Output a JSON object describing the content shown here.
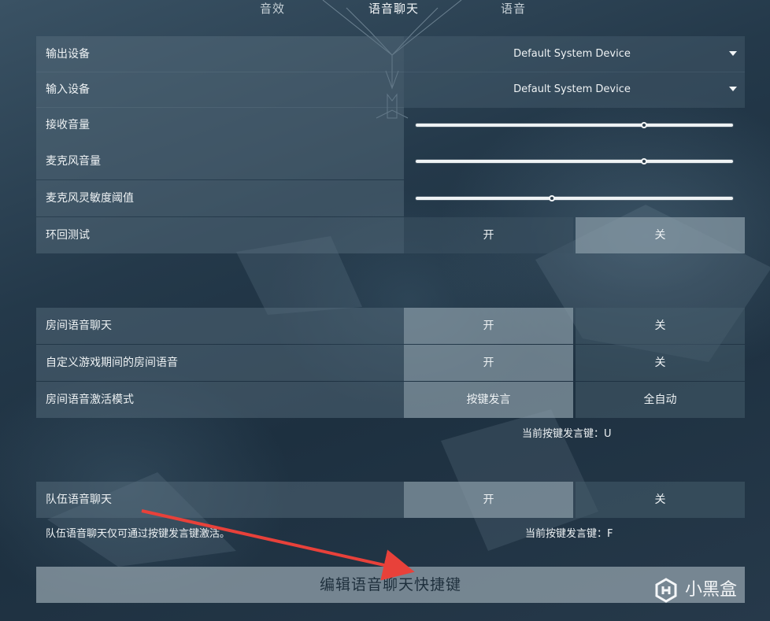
{
  "tabs": [
    {
      "label": "音效"
    },
    {
      "label": "语音聊天"
    },
    {
      "label": "语音"
    }
  ],
  "device": {
    "output": {
      "label": "输出设备",
      "value": "Default System Device"
    },
    "input": {
      "label": "输入设备",
      "value": "Default System Device"
    }
  },
  "sliders": {
    "receive_volume": {
      "label": "接收音量",
      "level": 0.72
    },
    "mic_volume": {
      "label": "麦克风音量",
      "level": 0.72
    },
    "mic_sensitivity": {
      "label": "麦克风灵敏度阈值",
      "level": 0.43
    }
  },
  "loopback": {
    "label": "环回测试",
    "on": "开",
    "off": "关",
    "selected": "off"
  },
  "party": {
    "room_chat": {
      "label": "房间语音聊天",
      "on": "开",
      "off": "关",
      "selected": "on"
    },
    "custom_game_room": {
      "label": "自定义游戏期间的房间语音",
      "on": "开",
      "off": "关"
    },
    "activation_mode": {
      "label": "房间语音激活模式",
      "ptt": "按键发言",
      "auto": "全自动",
      "selected": "ptt"
    },
    "ptt_key_note": "当前按键发言键：U"
  },
  "team": {
    "team_chat": {
      "label": "队伍语音聊天",
      "on": "开",
      "off": "关",
      "selected": "on"
    },
    "hint": "队伍语音聊天仅可通过按键发言键激活。",
    "ptt_key_note": "当前按键发言键：F"
  },
  "edit_keybinds_button": "编辑语音聊天快捷键",
  "watermark": {
    "text": "小黑盒"
  },
  "colors": {
    "annotation_arrow": "#e8413a"
  }
}
